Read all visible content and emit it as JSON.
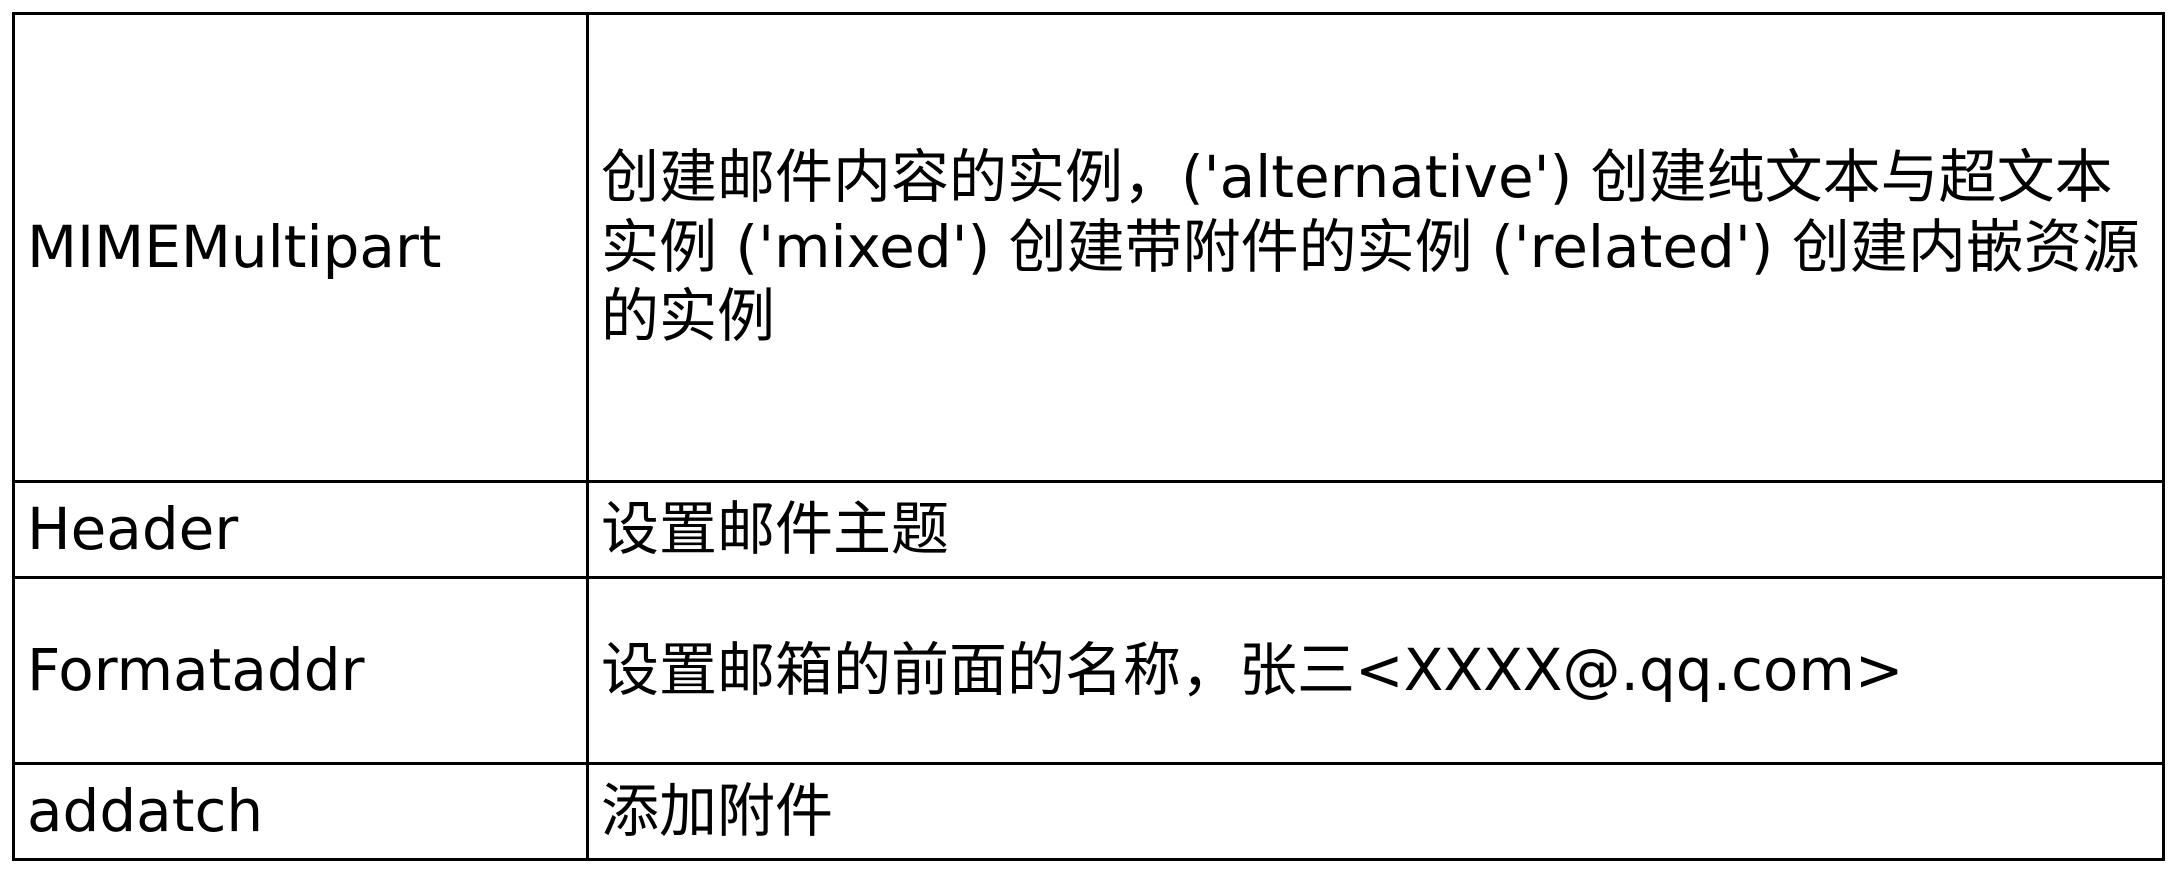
{
  "table": {
    "rows": [
      {
        "name": "MIMEMultipart",
        "description": "创建邮件内容的实例，('alternative') 创建纯文本与超文本实例 ('mixed') 创建带附件的实例 ('related') 创建内嵌资源的实例"
      },
      {
        "name": "Header",
        "description": "设置邮件主题"
      },
      {
        "name": "Formataddr",
        "description": "设置邮箱的前面的名称，张三<XXXX@.qq.com>"
      },
      {
        "name": "addatch",
        "description": "添加附件"
      }
    ]
  }
}
